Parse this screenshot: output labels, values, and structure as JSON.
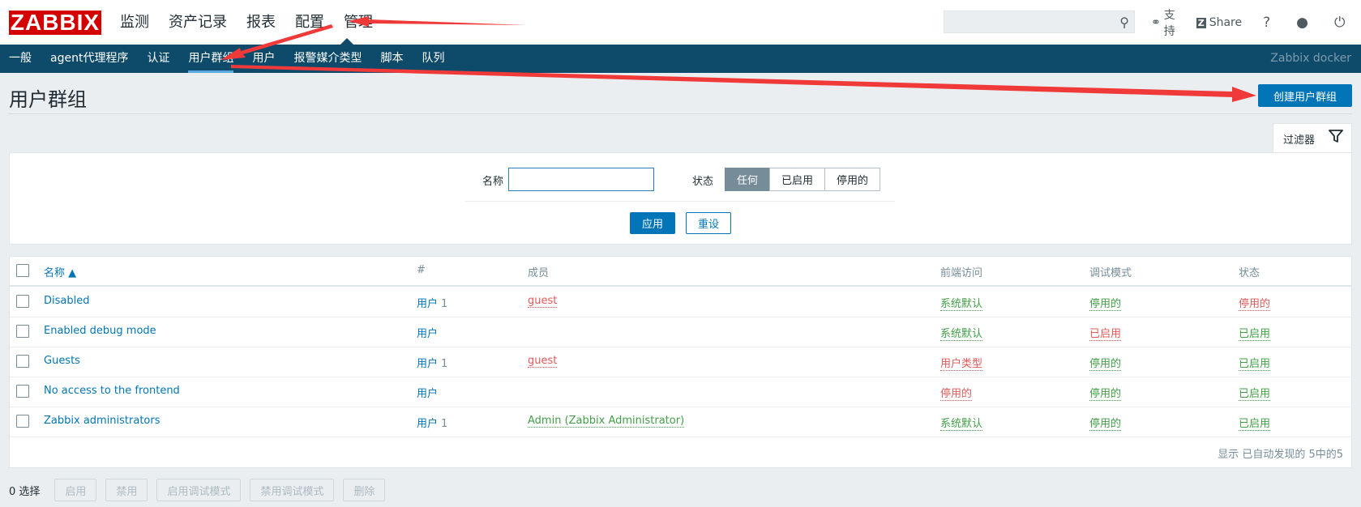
{
  "header": {
    "logo": "ZABBIX",
    "menu": [
      "监测",
      "资产记录",
      "报表",
      "配置",
      "管理"
    ],
    "active_menu": "管理",
    "search": {
      "value": "",
      "icon": "search-icon"
    },
    "support_label": "支持",
    "share_label": "Share",
    "help_label": "?",
    "icons": [
      "headset-icon",
      "share-icon",
      "user-icon",
      "power-icon"
    ]
  },
  "subnav": {
    "items": [
      "一般",
      "agent代理程序",
      "认证",
      "用户群组",
      "用户",
      "报警媒介类型",
      "脚本",
      "队列"
    ],
    "active": "用户群组",
    "server_name": "Zabbix docker"
  },
  "page": {
    "title": "用户群组",
    "create_button": "创建用户群组"
  },
  "filter": {
    "tab_label": "过滤器",
    "name_label": "名称",
    "name_value": "",
    "status_label": "状态",
    "status_options": [
      "任何",
      "已启用",
      "停用的"
    ],
    "status_selected": "任何",
    "apply_label": "应用",
    "reset_label": "重设"
  },
  "table": {
    "columns": {
      "name": "名称 ▲",
      "hash": "#",
      "members": "成员",
      "frontend": "前端访问",
      "debug": "调试模式",
      "status": "状态"
    },
    "rows": [
      {
        "name": "Disabled",
        "users": "用户",
        "count": "1",
        "members": "guest",
        "members_color": "red",
        "frontend": "系统默认",
        "frontend_color": "green",
        "debug": "停用的",
        "debug_color": "green",
        "status": "停用的",
        "status_color": "red"
      },
      {
        "name": "Enabled debug mode",
        "users": "用户",
        "count": "",
        "members": "",
        "members_color": "red",
        "frontend": "系统默认",
        "frontend_color": "green",
        "debug": "已启用",
        "debug_color": "red",
        "status": "已启用",
        "status_color": "green"
      },
      {
        "name": "Guests",
        "users": "用户",
        "count": "1",
        "members": "guest",
        "members_color": "red",
        "frontend": "用户类型",
        "frontend_color": "red",
        "debug": "停用的",
        "debug_color": "green",
        "status": "已启用",
        "status_color": "green"
      },
      {
        "name": "No access to the frontend",
        "users": "用户",
        "count": "",
        "members": "",
        "members_color": "red",
        "frontend": "停用的",
        "frontend_color": "red",
        "debug": "停用的",
        "debug_color": "green",
        "status": "已启用",
        "status_color": "green"
      },
      {
        "name": "Zabbix administrators",
        "users": "用户",
        "count": "1",
        "members": "Admin (Zabbix Administrator)",
        "members_color": "green",
        "frontend": "系统默认",
        "frontend_color": "green",
        "debug": "停用的",
        "debug_color": "green",
        "status": "已启用",
        "status_color": "green"
      }
    ],
    "footer": "显示 已自动发现的 5中的5"
  },
  "actions": {
    "selected": "0 选择",
    "buttons": [
      "启用",
      "禁用",
      "启用调试模式",
      "禁用调试模式",
      "删除"
    ]
  },
  "colors": {
    "accent": "#0275b8",
    "nav_bg": "#0e4b6b",
    "logo_bg": "#d40000",
    "green": "#429e47",
    "red": "#e45959",
    "annotation": "#f03a3a"
  }
}
